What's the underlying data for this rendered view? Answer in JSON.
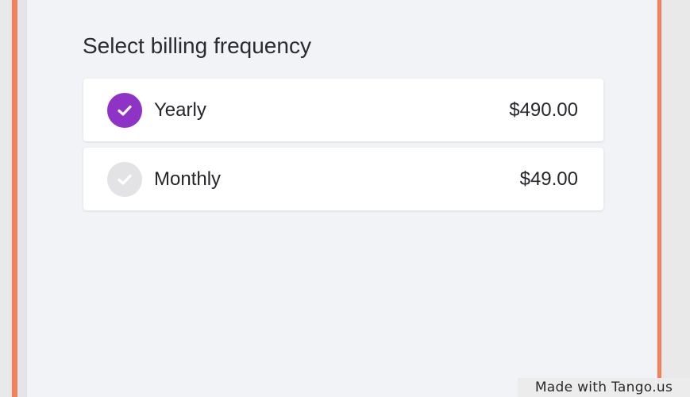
{
  "billing": {
    "heading": "Select billing frequency",
    "options": [
      {
        "label": "Yearly",
        "price": "$490.00",
        "selected": true,
        "icon": "check-circle-icon"
      },
      {
        "label": "Monthly",
        "price": "$49.00",
        "selected": false,
        "icon": "check-circle-icon"
      }
    ]
  },
  "watermark": {
    "text": "Made with Tango.us"
  },
  "colors": {
    "accent_border": "#f1825a",
    "selected_check": "#8f33c7",
    "unselected_check": "#e3e3e6",
    "panel_background": "#f2f3f7"
  }
}
